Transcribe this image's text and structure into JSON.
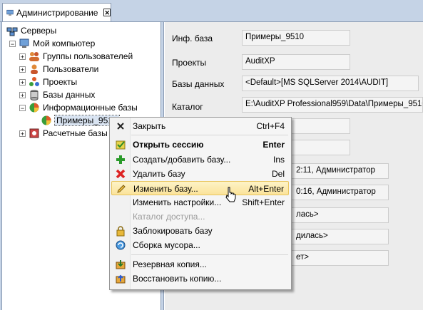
{
  "tab": {
    "title": "Администрирование",
    "close": "✕"
  },
  "tree": {
    "root": "Серверы",
    "computer": "Мой компьютер",
    "children": [
      "Группы пользователей",
      "Пользователи",
      "Проекты",
      "Базы данных",
      "Информационные базы"
    ],
    "selected": "Примеры_9510",
    "last": "Расчетные базы"
  },
  "details": {
    "labels": [
      "Инф. база",
      "Проекты",
      "Базы данных",
      "Каталог"
    ],
    "values": [
      "Примеры_9510",
      "AuditXP",
      "<Default>[MS SQLServer 2014\\AUDIT]",
      "E:\\AuditXP Professional959\\Data\\Примеры_9510"
    ],
    "partial": [
      "2:11, Администратор",
      "0:16, Администратор",
      "лась>",
      "дилась>",
      "ет>"
    ]
  },
  "menu": {
    "items": [
      {
        "label": "Закрыть",
        "shortcut": "Ctrl+F4",
        "icon": "close-icon"
      },
      {
        "label": "Открыть сессию",
        "shortcut": "Enter",
        "icon": "open-session-icon"
      },
      {
        "label": "Создать/добавить базу...",
        "shortcut": "Ins",
        "icon": "add-icon"
      },
      {
        "label": "Удалить базу",
        "shortcut": "Del",
        "icon": "delete-icon"
      },
      {
        "label": "Изменить базу...",
        "shortcut": "Alt+Enter",
        "icon": "pencil-icon"
      },
      {
        "label": "Изменить настройки...",
        "shortcut": "Shift+Enter",
        "icon": ""
      },
      {
        "label": "Каталог доступа...",
        "shortcut": "",
        "icon": ""
      },
      {
        "label": "Заблокировать базу",
        "shortcut": "",
        "icon": "lock-icon"
      },
      {
        "label": "Сборка мусора...",
        "shortcut": "",
        "icon": "garbage-collect-icon"
      },
      {
        "label": "Резервная копия...",
        "shortcut": "",
        "icon": "backup-icon"
      },
      {
        "label": "Восстановить копию...",
        "shortcut": "",
        "icon": "restore-icon"
      }
    ]
  }
}
